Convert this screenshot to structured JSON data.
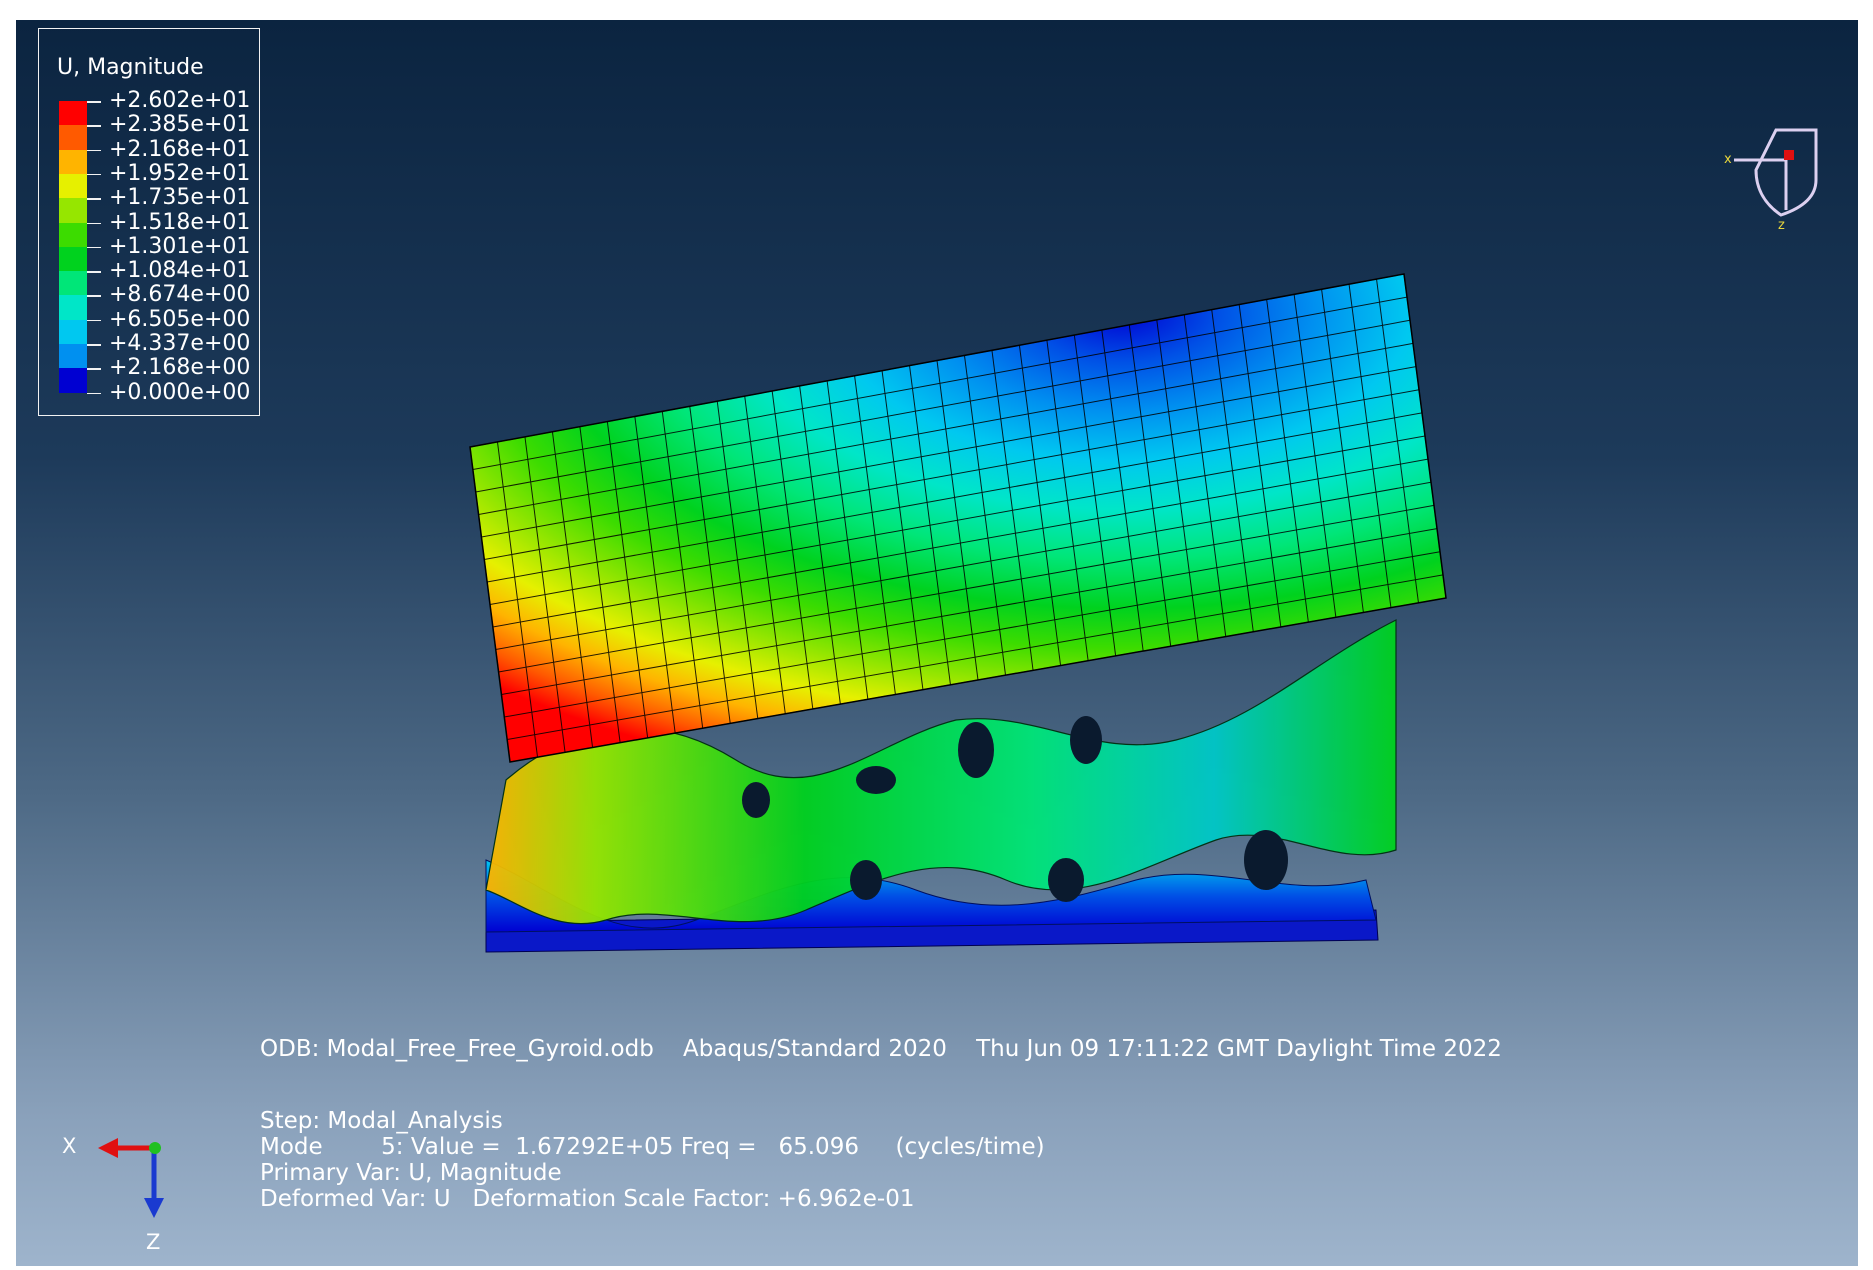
{
  "legend": {
    "title": "U, Magnitude",
    "levels": [
      {
        "label": "+2.602e+01",
        "color": "#ff0000"
      },
      {
        "label": "+2.385e+01",
        "color": "#ff5a00"
      },
      {
        "label": "+2.168e+01",
        "color": "#ffb400"
      },
      {
        "label": "+1.952e+01",
        "color": "#e6f000"
      },
      {
        "label": "+1.735e+01",
        "color": "#96e600"
      },
      {
        "label": "+1.518e+01",
        "color": "#3cdc00"
      },
      {
        "label": "+1.301e+01",
        "color": "#00d21e"
      },
      {
        "label": "+1.084e+01",
        "color": "#00e678"
      },
      {
        "label": "+8.674e+00",
        "color": "#00e6c8"
      },
      {
        "label": "+6.505e+00",
        "color": "#00c8f0"
      },
      {
        "label": "+4.337e+00",
        "color": "#0090f0"
      },
      {
        "label": "+2.168e+00",
        "color": "#0050e6"
      },
      {
        "label": "+0.000e+00",
        "color": "#0000d2"
      }
    ]
  },
  "info": {
    "odb_line": "ODB: Modal_Free_Free_Gyroid.odb    Abaqus/Standard 2020    Thu Jun 09 17:11:22 GMT Daylight Time 2022",
    "step_line": "Step: Modal_Analysis",
    "mode_line": "Mode        5: Value =  1.67292E+05 Freq =   65.096     (cycles/time)",
    "primary_line": "Primary Var: U, Magnitude",
    "deformed_line": "Deformed Var: U   Deformation Scale Factor: +6.962e-01"
  },
  "triad": {
    "x_label": "X",
    "z_label": "Z"
  },
  "mini_triad": {
    "x_label": "x",
    "z_label": "z"
  },
  "colors": {
    "axis_x": "#e01010",
    "axis_z": "#1a3ad0",
    "axis_y": "#20c020"
  }
}
